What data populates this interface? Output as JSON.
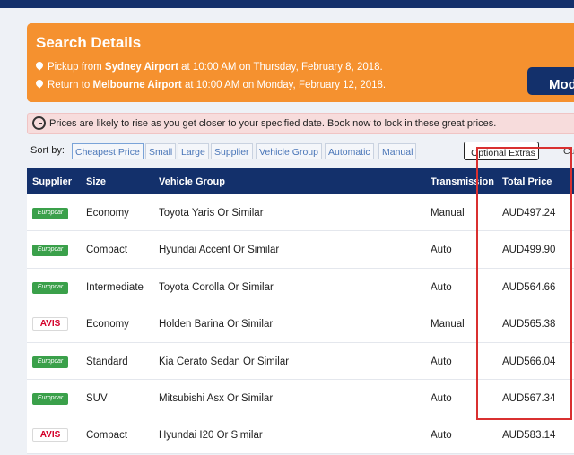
{
  "search": {
    "title": "Search Details",
    "pickup_prefix": "Pickup from ",
    "pickup_location": "Sydney Airport",
    "pickup_time": " at 10:00 AM on Thursday, February 8, 2018.",
    "return_prefix": "Return to ",
    "return_location": "Melbourne Airport",
    "return_time": " at 10:00 AM on Monday, February 12, 2018.",
    "modify_label": "Mod"
  },
  "alert": {
    "text": "Prices are likely to rise as you get closer to your specified date. Book now to lock in these great prices."
  },
  "sort": {
    "label": "Sort by:",
    "options": [
      "Cheapest Price",
      "Small",
      "Large",
      "Supplier",
      "Vehicle Group",
      "Automatic",
      "Manual"
    ],
    "active": "Cheapest Price",
    "extras_label": "Optional Extras",
    "cut_label": "Cu"
  },
  "table": {
    "headers": {
      "supplier": "Supplier",
      "size": "Size",
      "vehicle": "Vehicle Group",
      "transmission": "Transmission",
      "price": "Total Price"
    },
    "rows": [
      {
        "supplier": "Europcar",
        "size": "Economy",
        "vehicle": "Toyota Yaris Or Similar",
        "transmission": "Manual",
        "price": "AUD497.24"
      },
      {
        "supplier": "Europcar",
        "size": "Compact",
        "vehicle": "Hyundai Accent Or Similar",
        "transmission": "Auto",
        "price": "AUD499.90"
      },
      {
        "supplier": "Europcar",
        "size": "Intermediate",
        "vehicle": "Toyota Corolla Or Similar",
        "transmission": "Auto",
        "price": "AUD564.66"
      },
      {
        "supplier": "AVIS",
        "size": "Economy",
        "vehicle": "Holden Barina Or Similar",
        "transmission": "Manual",
        "price": "AUD565.38"
      },
      {
        "supplier": "Europcar",
        "size": "Standard",
        "vehicle": "Kia Cerato Sedan Or Similar",
        "transmission": "Auto",
        "price": "AUD566.04"
      },
      {
        "supplier": "Europcar",
        "size": "SUV",
        "vehicle": "Mitsubishi Asx Or Similar",
        "transmission": "Auto",
        "price": "AUD567.34"
      },
      {
        "supplier": "AVIS",
        "size": "Compact",
        "vehicle": "Hyundai I20 Or Similar",
        "transmission": "Auto",
        "price": "AUD583.14"
      }
    ]
  },
  "colors": {
    "header_navy": "#13306b",
    "search_orange": "#f5912f",
    "alert_pink": "#f7dcdc",
    "highlight_red": "#d93030",
    "europcar_green": "#3aa04a",
    "avis_red": "#d4002a"
  }
}
